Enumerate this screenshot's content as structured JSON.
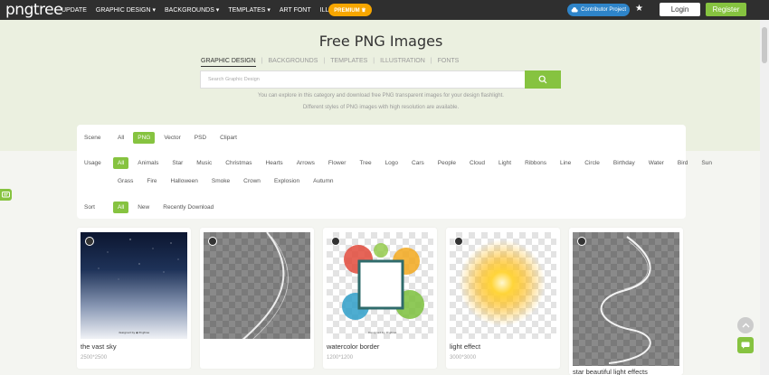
{
  "nav": {
    "logo": "pngtree",
    "links": [
      "UPDATE",
      "GRAPHIC DESIGN ▾",
      "BACKGROUNDS ▾",
      "TEMPLATES ▾",
      "ART FONT",
      "ILLUSTRATION"
    ],
    "premium": "PREMIUM ♛",
    "contributor": "Contributor Project",
    "login": "Login",
    "register": "Register"
  },
  "hero": {
    "title": "Free PNG Images",
    "tabs": [
      "GRAPHIC DESIGN",
      "BACKGROUNDS",
      "TEMPLATES",
      "ILLUSTRATION",
      "FONTS"
    ],
    "active_tab": "GRAPHIC DESIGN",
    "search_placeholder": "Search Graphic Design",
    "desc1": "You can explore in this category and download free PNG transparent images for your design flashlight.",
    "desc2": "Different styles of PNG images with high resolution are available."
  },
  "filters": {
    "scene": {
      "label": "Scene",
      "options": [
        "All",
        "PNG",
        "Vector",
        "PSD",
        "Clipart"
      ],
      "active": "PNG"
    },
    "usage": {
      "label": "Usage",
      "options": [
        "All",
        "Animals",
        "Star",
        "Music",
        "Christmas",
        "Hearts",
        "Arrows",
        "Flower",
        "Tree",
        "Logo",
        "Cars",
        "People",
        "Cloud",
        "Light",
        "Ribbons",
        "Line",
        "Circle",
        "Birthday",
        "Water",
        "Bird",
        "Sun",
        "Grass",
        "Fire",
        "Halloween",
        "Smoke",
        "Crown",
        "Explosion",
        "Autumn"
      ],
      "active": "All"
    },
    "sort": {
      "label": "Sort",
      "options": [
        "All",
        "New",
        "Recently Download"
      ],
      "active": "All"
    }
  },
  "cards": [
    {
      "title": "the vast sky",
      "size": "2500*2500"
    },
    {
      "title": "",
      "size": ""
    },
    {
      "title": "watercolor border",
      "size": "1200*1200"
    },
    {
      "title": "light effect",
      "size": "3000*3000"
    },
    {
      "title": "star beautiful light effects",
      "size": ""
    }
  ],
  "colors": {
    "accent": "#86c340",
    "nav_bg": "#2f2f2f",
    "hero_bg": "#ebf0e0"
  }
}
